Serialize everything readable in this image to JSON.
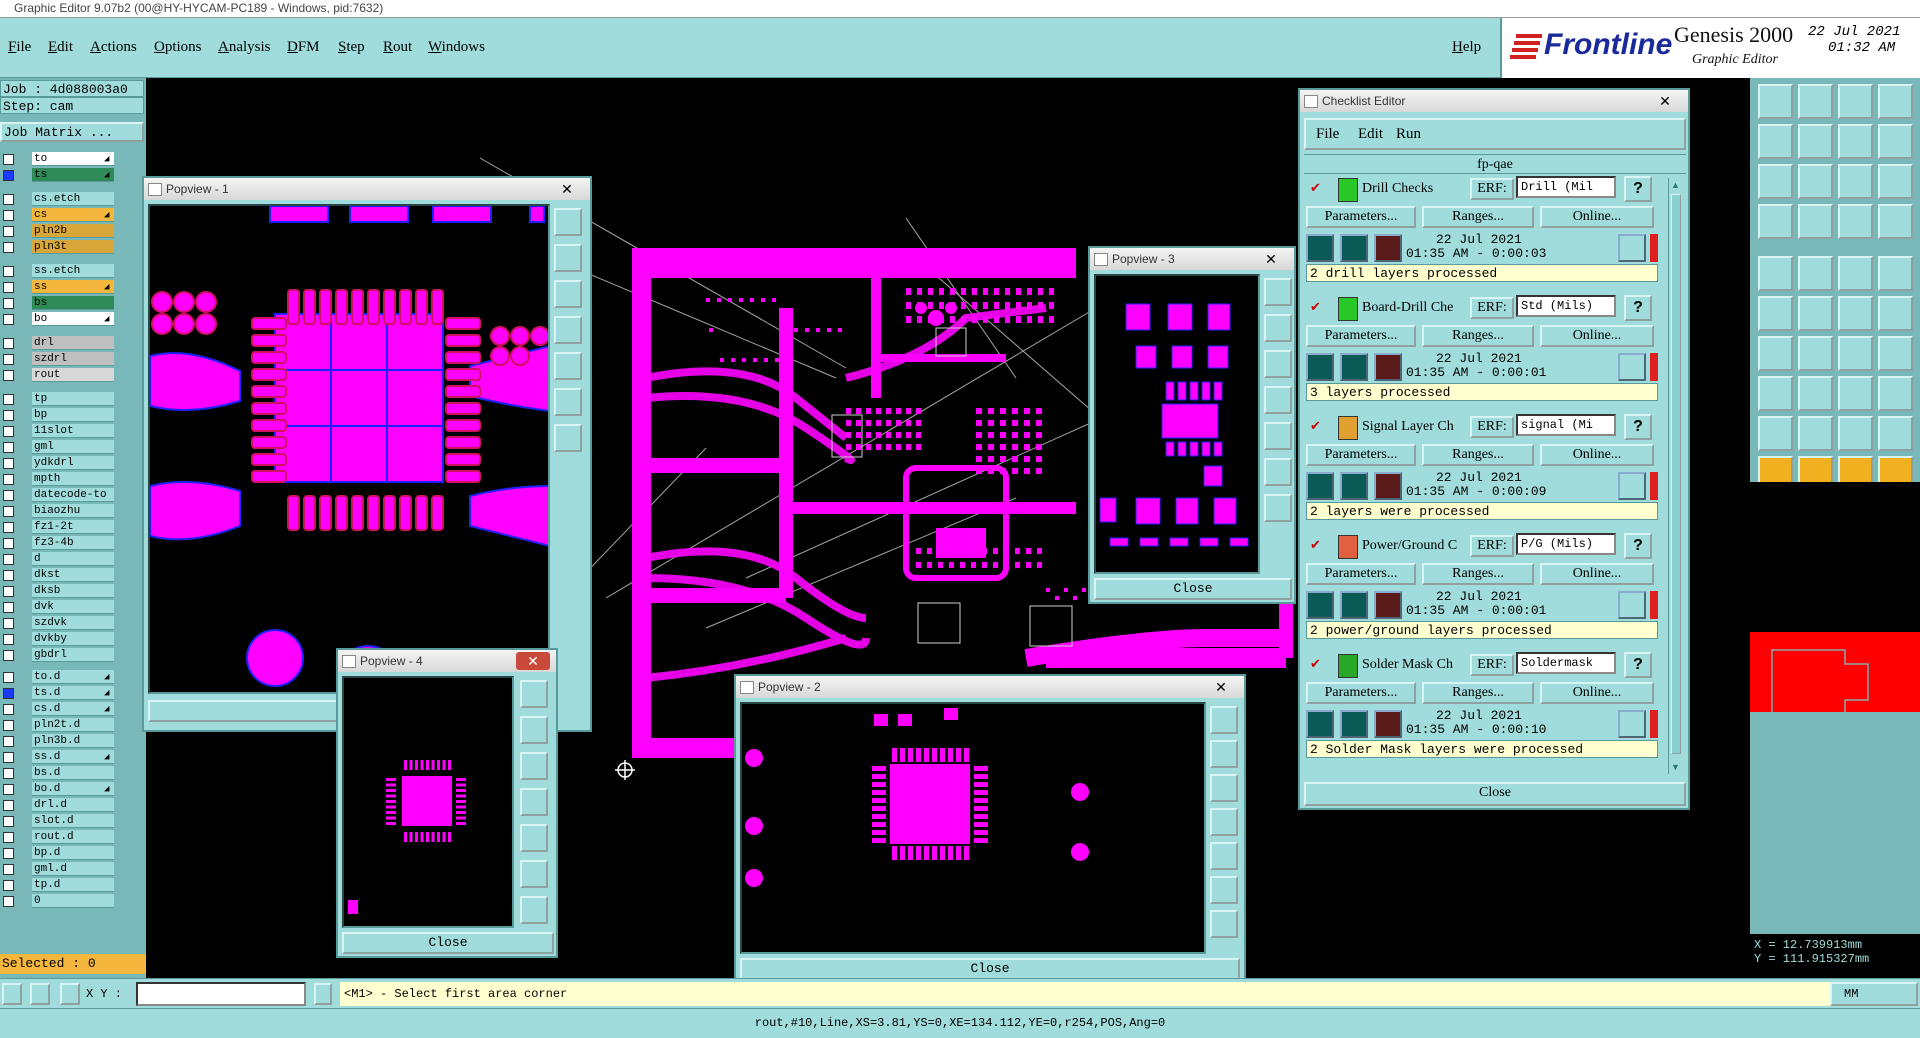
{
  "window": {
    "title": "Graphic Editor 9.07b2 (00@HY-HYCAM-PC189 - Windows, pid:7632)"
  },
  "menu": {
    "items": [
      "File",
      "Edit",
      "Actions",
      "Options",
      "Analysis",
      "DFM",
      "Step",
      "Rout",
      "Windows"
    ],
    "help": "Help"
  },
  "brand": {
    "logo": "Frontline",
    "product": "Genesis 2000",
    "subtitle": "Graphic Editor",
    "date": "22 Jul 2021",
    "time": "01:32 AM"
  },
  "job": {
    "job_line": "Job : 4d088003a0",
    "step_line": "Step: cam",
    "matrix_button": "Job Matrix ..."
  },
  "layers": [
    {
      "name": "to",
      "color": "#ffffff",
      "arrow": true
    },
    {
      "name": "ts",
      "color": "#2e8b57",
      "arrow": true,
      "active": true
    },
    {
      "name": "cs.etch",
      "color": "#a0dcdc"
    },
    {
      "name": "cs",
      "color": "#f4b63c",
      "arrow": true
    },
    {
      "name": "pln2b",
      "color": "#d9a63a"
    },
    {
      "name": "pln3t",
      "color": "#d9a63a"
    },
    {
      "name": "ss.etch",
      "color": "#a0dcdc"
    },
    {
      "name": "ss",
      "color": "#f4b63c",
      "arrow": true
    },
    {
      "name": "bs",
      "color": "#2e8b57"
    },
    {
      "name": "bo",
      "color": "#ffffff",
      "arrow": true
    },
    {
      "name": "drl",
      "color": "#c0c0c0"
    },
    {
      "name": "szdrl",
      "color": "#c0c0c0"
    },
    {
      "name": "rout",
      "color": "#d8d8d8"
    },
    {
      "name": "tp"
    },
    {
      "name": "bp"
    },
    {
      "name": "11slot"
    },
    {
      "name": "gml"
    },
    {
      "name": "ydkdrl"
    },
    {
      "name": "mpth"
    },
    {
      "name": "datecode-to"
    },
    {
      "name": "biaozhu"
    },
    {
      "name": "fz1-2t"
    },
    {
      "name": "fz3-4b"
    },
    {
      "name": "d"
    },
    {
      "name": "dkst"
    },
    {
      "name": "dksb"
    },
    {
      "name": "dvk"
    },
    {
      "name": "szdvk"
    },
    {
      "name": "dvkby"
    },
    {
      "name": "gbdrl"
    },
    {
      "name": "to.d",
      "arrow": true
    },
    {
      "name": "ts.d",
      "arrow": true,
      "active": true
    },
    {
      "name": "cs.d",
      "arrow": true
    },
    {
      "name": "pln2t.d"
    },
    {
      "name": "pln3b.d"
    },
    {
      "name": "ss.d",
      "arrow": true
    },
    {
      "name": "bs.d"
    },
    {
      "name": "bo.d",
      "arrow": true
    },
    {
      "name": "drl.d"
    },
    {
      "name": "slot.d"
    },
    {
      "name": "rout.d"
    },
    {
      "name": "bp.d"
    },
    {
      "name": "gml.d"
    },
    {
      "name": "tp.d"
    },
    {
      "name": "0"
    }
  ],
  "selected": "Selected : 0",
  "popviews": {
    "p1": {
      "title": "Popview - 1"
    },
    "p2": {
      "title": "Popview - 2",
      "close": "Close"
    },
    "p3": {
      "title": "Popview - 3",
      "close": "Close"
    },
    "p4": {
      "title": "Popview - 4",
      "close": "Close"
    }
  },
  "checklist": {
    "title": "Checklist Editor",
    "menu": [
      "File",
      "Edit",
      "Run"
    ],
    "name": "fp-qae",
    "erf_label": "ERF:",
    "btn_params": "Parameters...",
    "btn_ranges": "Ranges...",
    "btn_online": "Online...",
    "close": "Close",
    "actions": [
      {
        "name": "Drill Checks",
        "erf": "Drill (Mil",
        "date": "22 Jul 2021",
        "time": "01:35 AM - 0:00:03",
        "status": "2 drill layers processed",
        "icon_color": "#28c828"
      },
      {
        "name": "Board-Drill Che",
        "erf": "Std (Mils)",
        "date": "22 Jul 2021",
        "time": "01:35 AM - 0:00:01",
        "status": "3 layers processed",
        "icon_color": "#28c828"
      },
      {
        "name": "Signal Layer Ch",
        "erf": "signal (Mi",
        "date": "22 Jul 2021",
        "time": "01:35 AM - 0:00:09",
        "status": "2 layers were processed",
        "icon_color": "#e0a030"
      },
      {
        "name": "Power/Ground C",
        "erf": "P/G (Mils)",
        "date": "22 Jul 2021",
        "time": "01:35 AM - 0:00:01",
        "status": "2 power/ground layers processed",
        "icon_color": "#e06040"
      },
      {
        "name": "Solder Mask Ch",
        "erf": "Soldermask",
        "date": "22 Jul 2021",
        "time": "01:35 AM - 0:00:10",
        "status": "2 Solder Mask layers were processed",
        "icon_color": "#28a828"
      }
    ]
  },
  "coords": {
    "x": "X = 12.739913mm",
    "y": "Y = 111.915327mm",
    "units": "MM"
  },
  "prompt": {
    "xy_label": "X Y :",
    "message": "<M1> - Select first area corner"
  },
  "status_line": "rout,#10,Line,XS=3.81,YS=0,XE=134.112,YE=0,r254,POS,Ang=0",
  "colors": {
    "panel": "#a0dcdc",
    "panel_dark": "#78b8b8",
    "feature": "#ff00ff",
    "outline": "#2020ff",
    "status_yellow": "#ffffd0"
  }
}
